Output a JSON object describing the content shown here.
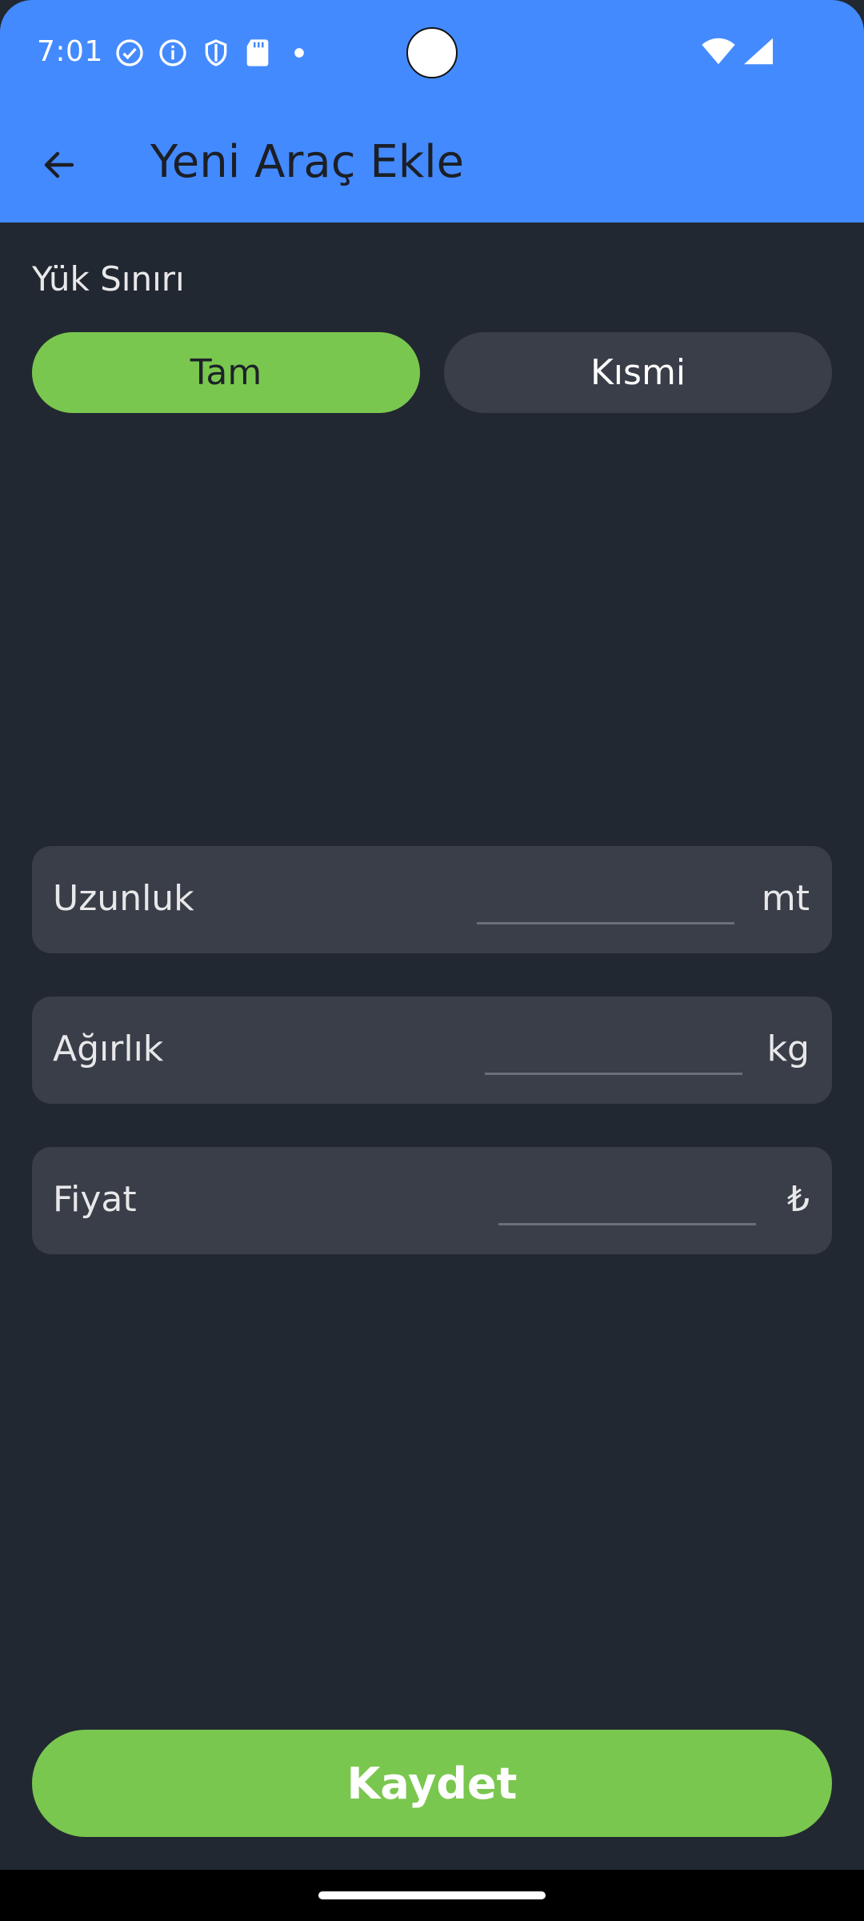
{
  "status_bar": {
    "time": "7:01",
    "icons": [
      "check-circle-icon",
      "info-icon",
      "shield-icon",
      "sd-card-icon",
      "dot-icon"
    ],
    "right_icons": [
      "wifi-icon",
      "cellular-signal-icon"
    ]
  },
  "app_bar": {
    "title": "Yeni Araç Ekle",
    "back_icon": "arrow-left-icon",
    "background_color": "#448AFF"
  },
  "load_limit": {
    "label": "Yük Sınırı",
    "options": [
      {
        "label": "Tam",
        "selected": true
      },
      {
        "label": "Kısmi",
        "selected": false
      }
    ],
    "selected_color": "#7AC74F",
    "unselected_color": "#3A3E48"
  },
  "fields": {
    "length": {
      "label": "Uzunluk",
      "value": "",
      "unit": "mt"
    },
    "weight": {
      "label": "Ağırlık",
      "value": "",
      "unit": "kg"
    },
    "price": {
      "label": "Fiyat",
      "value": "",
      "unit": "₺"
    }
  },
  "actions": {
    "save_label": "Kaydet",
    "save_color": "#7AC74F"
  },
  "theme": {
    "background": "#222831",
    "field_background": "#3A3E48"
  }
}
